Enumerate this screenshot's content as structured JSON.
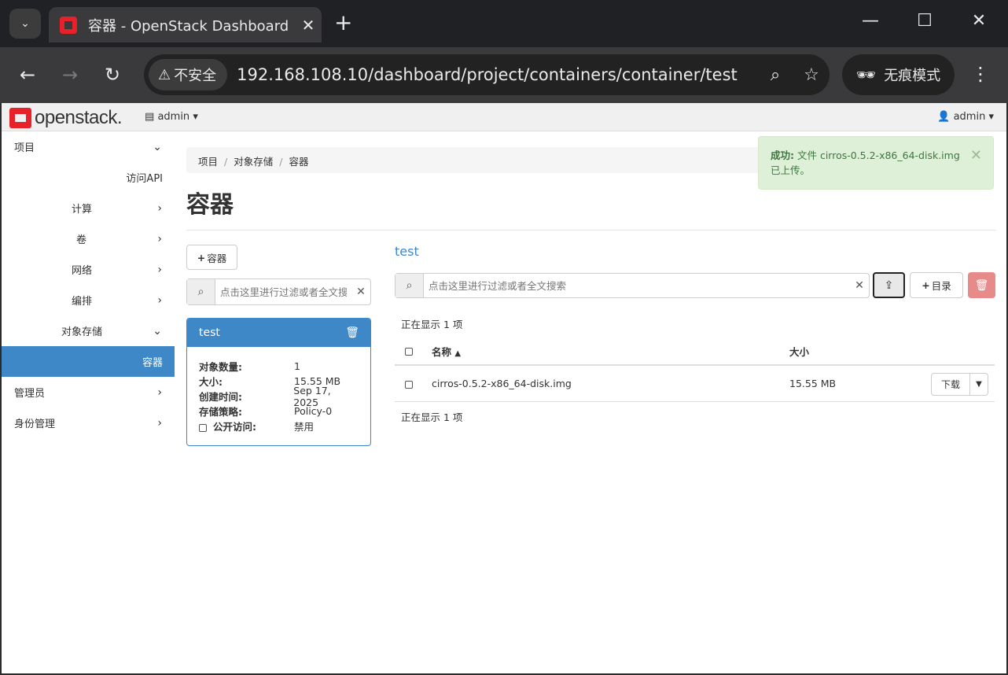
{
  "browser": {
    "tab_title": "容器 - OpenStack Dashboard",
    "tab_close": "✕",
    "new_tab": "+",
    "security_label": "不安全",
    "url": "192.168.108.10/dashboard/project/containers/container/test",
    "incognito_label": "无痕模式"
  },
  "topnav": {
    "logo_text": "openstack.",
    "project_label": "admin",
    "user_label": "admin"
  },
  "sidebar": {
    "items": [
      {
        "label": "项目"
      },
      {
        "label": "访问API"
      },
      {
        "label": "计算"
      },
      {
        "label": "卷"
      },
      {
        "label": "网络"
      },
      {
        "label": "编排"
      },
      {
        "label": "对象存储"
      },
      {
        "label": "容器"
      },
      {
        "label": "管理员"
      },
      {
        "label": "身份管理"
      }
    ]
  },
  "breadcrumb": [
    "项目",
    "对象存储",
    "容器"
  ],
  "page_title": "容器",
  "alert": {
    "prefix": "成功:",
    "message": " 文件 cirros-0.5.2-x86_64-disk.img 已上传。"
  },
  "left": {
    "add_container_label": "容器",
    "search_placeholder": "点击这里进行过滤或者全文搜索",
    "card": {
      "name": "test",
      "fields": [
        {
          "key": "对象数量:",
          "value": "1"
        },
        {
          "key": "大小:",
          "value": "15.55 MB"
        },
        {
          "key": "创建时间:",
          "value": "Sep 17, 2025"
        },
        {
          "key": "存储策略:",
          "value": "Policy-0"
        },
        {
          "key": "公开访问:",
          "value": "禁用"
        }
      ]
    }
  },
  "right": {
    "title": "test",
    "search_placeholder": "点击这里进行过滤或者全文搜索",
    "dir_label": "目录",
    "showing_top": "正在显示 1 项",
    "showing_bottom": "正在显示 1 项",
    "columns": {
      "name": "名称",
      "size": "大小"
    },
    "rows": [
      {
        "name": "cirros-0.5.2-x86_64-disk.img",
        "size": "15.55 MB",
        "action": "下载"
      }
    ]
  }
}
